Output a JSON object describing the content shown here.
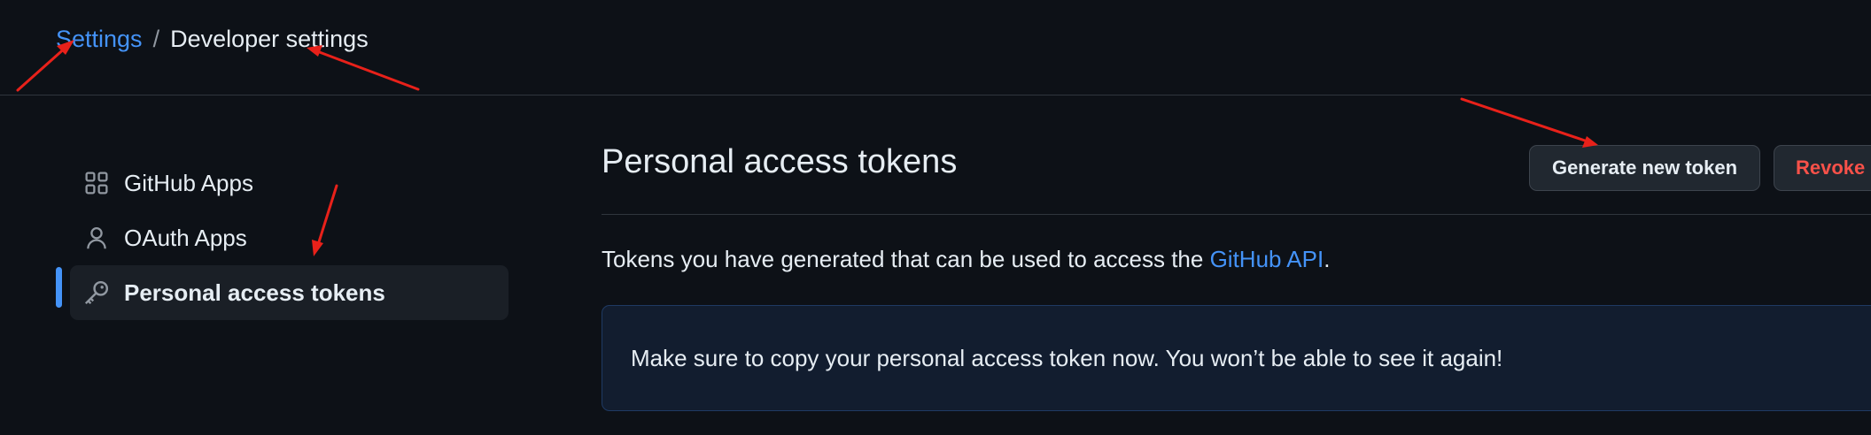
{
  "breadcrumb": {
    "parent": "Settings",
    "separator": "/",
    "current": "Developer settings"
  },
  "sidebar": {
    "items": [
      {
        "label": "GitHub Apps",
        "icon": "apps-grid-icon",
        "active": false
      },
      {
        "label": "OAuth Apps",
        "icon": "person-icon",
        "active": false
      },
      {
        "label": "Personal access tokens",
        "icon": "key-icon",
        "active": true
      }
    ]
  },
  "main": {
    "title": "Personal access tokens",
    "generate_button": "Generate new token",
    "revoke_button": "Revoke a",
    "description_prefix": "Tokens you have generated that can be used to access the ",
    "description_link": "GitHub API",
    "description_suffix": ".",
    "notice": "Make sure to copy your personal access token now. You won’t be able to see it again!"
  },
  "colors": {
    "background": "#0d1117",
    "link": "#4493f8",
    "danger": "#f85149",
    "annotation": "#e8211a"
  }
}
